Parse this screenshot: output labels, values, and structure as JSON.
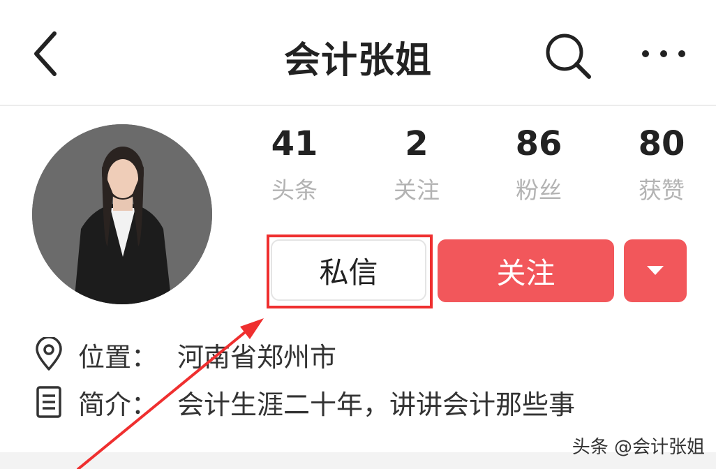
{
  "header": {
    "title": "会计张姐",
    "back_icon": "chevron-left-icon",
    "search_icon": "search-icon",
    "more_icon": "more-icon"
  },
  "stats": [
    {
      "value": "41",
      "label": "头条"
    },
    {
      "value": "2",
      "label": "关注"
    },
    {
      "value": "86",
      "label": "粉丝"
    },
    {
      "value": "80",
      "label": "获赞"
    }
  ],
  "actions": {
    "message_label": "私信",
    "follow_label": "关注",
    "dropdown_icon": "caret-down-icon"
  },
  "info": {
    "location_label": "位置：",
    "location_value": "河南省郑州市",
    "bio_label": "简介：",
    "bio_value": "会计生涯二十年，讲讲会计那些事"
  },
  "watermark": "头条 @会计张姐",
  "colors": {
    "accent": "#f2575b",
    "annotation": "#ef2f2f",
    "muted_text": "#b3b3b3"
  }
}
